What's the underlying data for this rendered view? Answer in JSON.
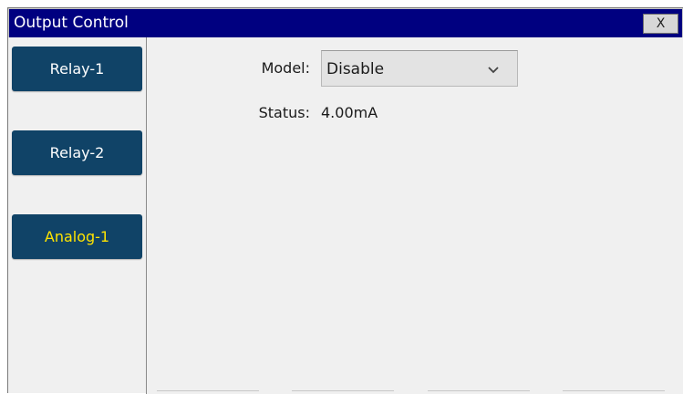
{
  "window": {
    "title": "Output Control",
    "close_label": "X"
  },
  "sidebar": {
    "items": [
      {
        "label": "Relay-1",
        "active": false
      },
      {
        "label": "Relay-2",
        "active": false
      },
      {
        "label": "Analog-1",
        "active": true
      }
    ]
  },
  "form": {
    "model_label": "Model:",
    "model_value": "Disable",
    "status_label": "Status:",
    "status_value": "4.00mA"
  },
  "icons": {
    "dropdown": "chevron-down-icon"
  },
  "colors": {
    "titlebar": "#000080",
    "nav_button": "#104367",
    "active_label": "#ffe400",
    "background": "#f0f0f0"
  }
}
